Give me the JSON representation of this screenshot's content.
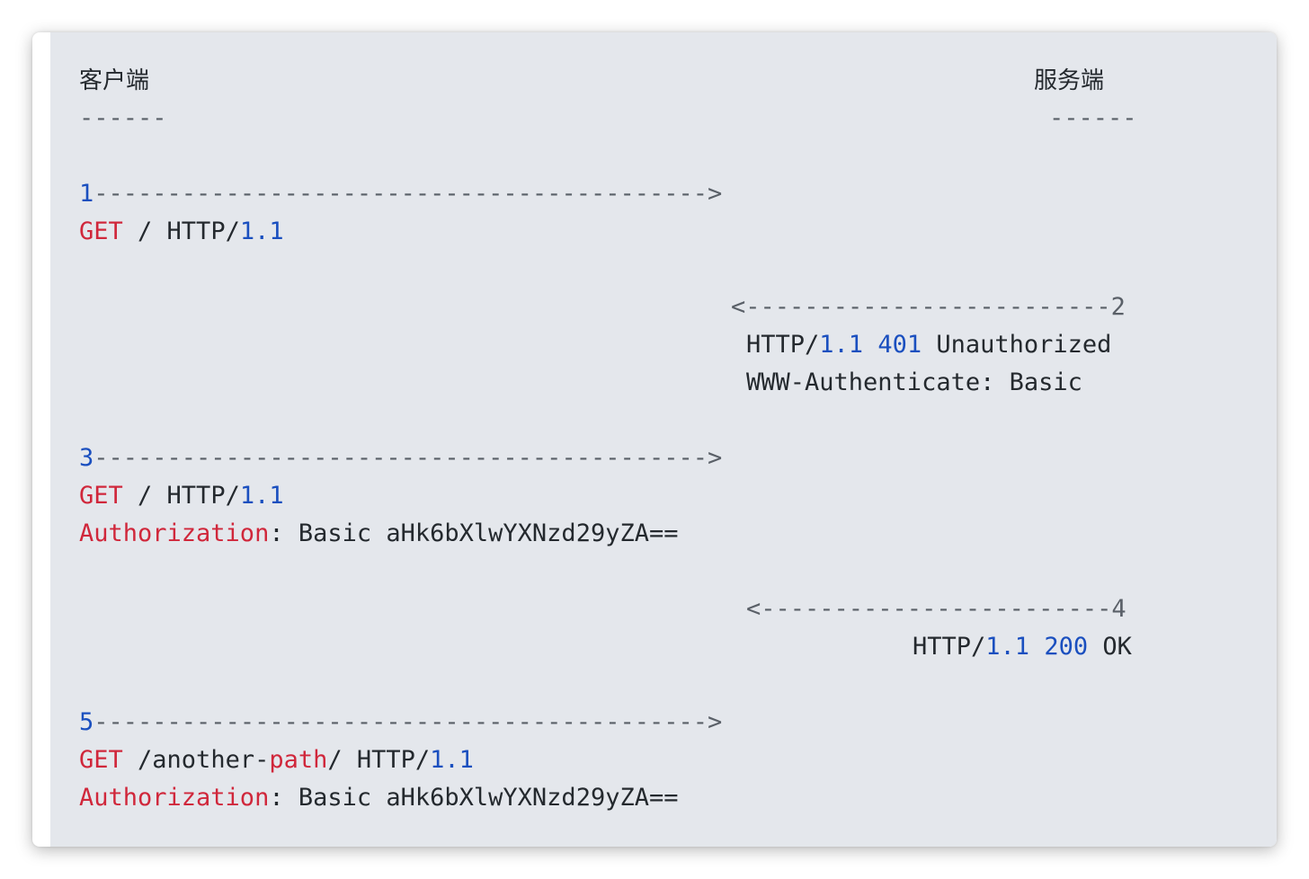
{
  "headers": {
    "client": "客户端",
    "server": "服务端",
    "client_underline": "------",
    "server_underline": "------"
  },
  "steps": [
    {
      "arrow": {
        "prefix": "1",
        "line": "------------------------------------------>"
      },
      "lines": [
        [
          {
            "t": "GET",
            "c": "kw"
          },
          {
            "t": " / HTTP/",
            "c": ""
          },
          {
            "t": "1.1",
            "c": "num"
          }
        ]
      ]
    },
    {
      "arrow": {
        "line": "<-------------------------",
        "suffix": "2"
      },
      "lines": [
        [
          {
            "t": "HTTP/",
            "c": ""
          },
          {
            "t": "1.1",
            "c": "num"
          },
          {
            "t": " ",
            "c": ""
          },
          {
            "t": "401",
            "c": "num"
          },
          {
            "t": " Unauthorized",
            "c": ""
          }
        ],
        [
          {
            "t": "WWW-Authenticate: Basic",
            "c": ""
          }
        ]
      ]
    },
    {
      "arrow": {
        "prefix": "3",
        "line": "------------------------------------------>"
      },
      "lines": [
        [
          {
            "t": "GET",
            "c": "kw"
          },
          {
            "t": " / HTTP/",
            "c": ""
          },
          {
            "t": "1.1",
            "c": "num"
          }
        ],
        [
          {
            "t": "Authorization",
            "c": "kw"
          },
          {
            "t": ": Basic aHk6bXlwYXNzd29yZA==",
            "c": ""
          }
        ]
      ]
    },
    {
      "arrow": {
        "line": "<------------------------",
        "suffix": "4"
      },
      "lines": [
        [
          {
            "t": "HTTP/",
            "c": ""
          },
          {
            "t": "1.1",
            "c": "num"
          },
          {
            "t": " ",
            "c": ""
          },
          {
            "t": "200",
            "c": "num"
          },
          {
            "t": " OK",
            "c": ""
          }
        ]
      ]
    },
    {
      "arrow": {
        "prefix": "5",
        "line": "------------------------------------------>"
      },
      "lines": [
        [
          {
            "t": "GET",
            "c": "kw"
          },
          {
            "t": " /another-",
            "c": ""
          },
          {
            "t": "path",
            "c": "kw"
          },
          {
            "t": "/ HTTP/",
            "c": ""
          },
          {
            "t": "1.1",
            "c": "num"
          }
        ],
        [
          {
            "t": "Authorization",
            "c": "kw"
          },
          {
            "t": ": Basic aHk6bXlwYXNzd29yZA==",
            "c": ""
          }
        ]
      ]
    }
  ],
  "colors": {
    "keyword": "#d0273b",
    "number": "#1a4fbf",
    "text": "#24292e",
    "background": "#e4e7ec"
  }
}
